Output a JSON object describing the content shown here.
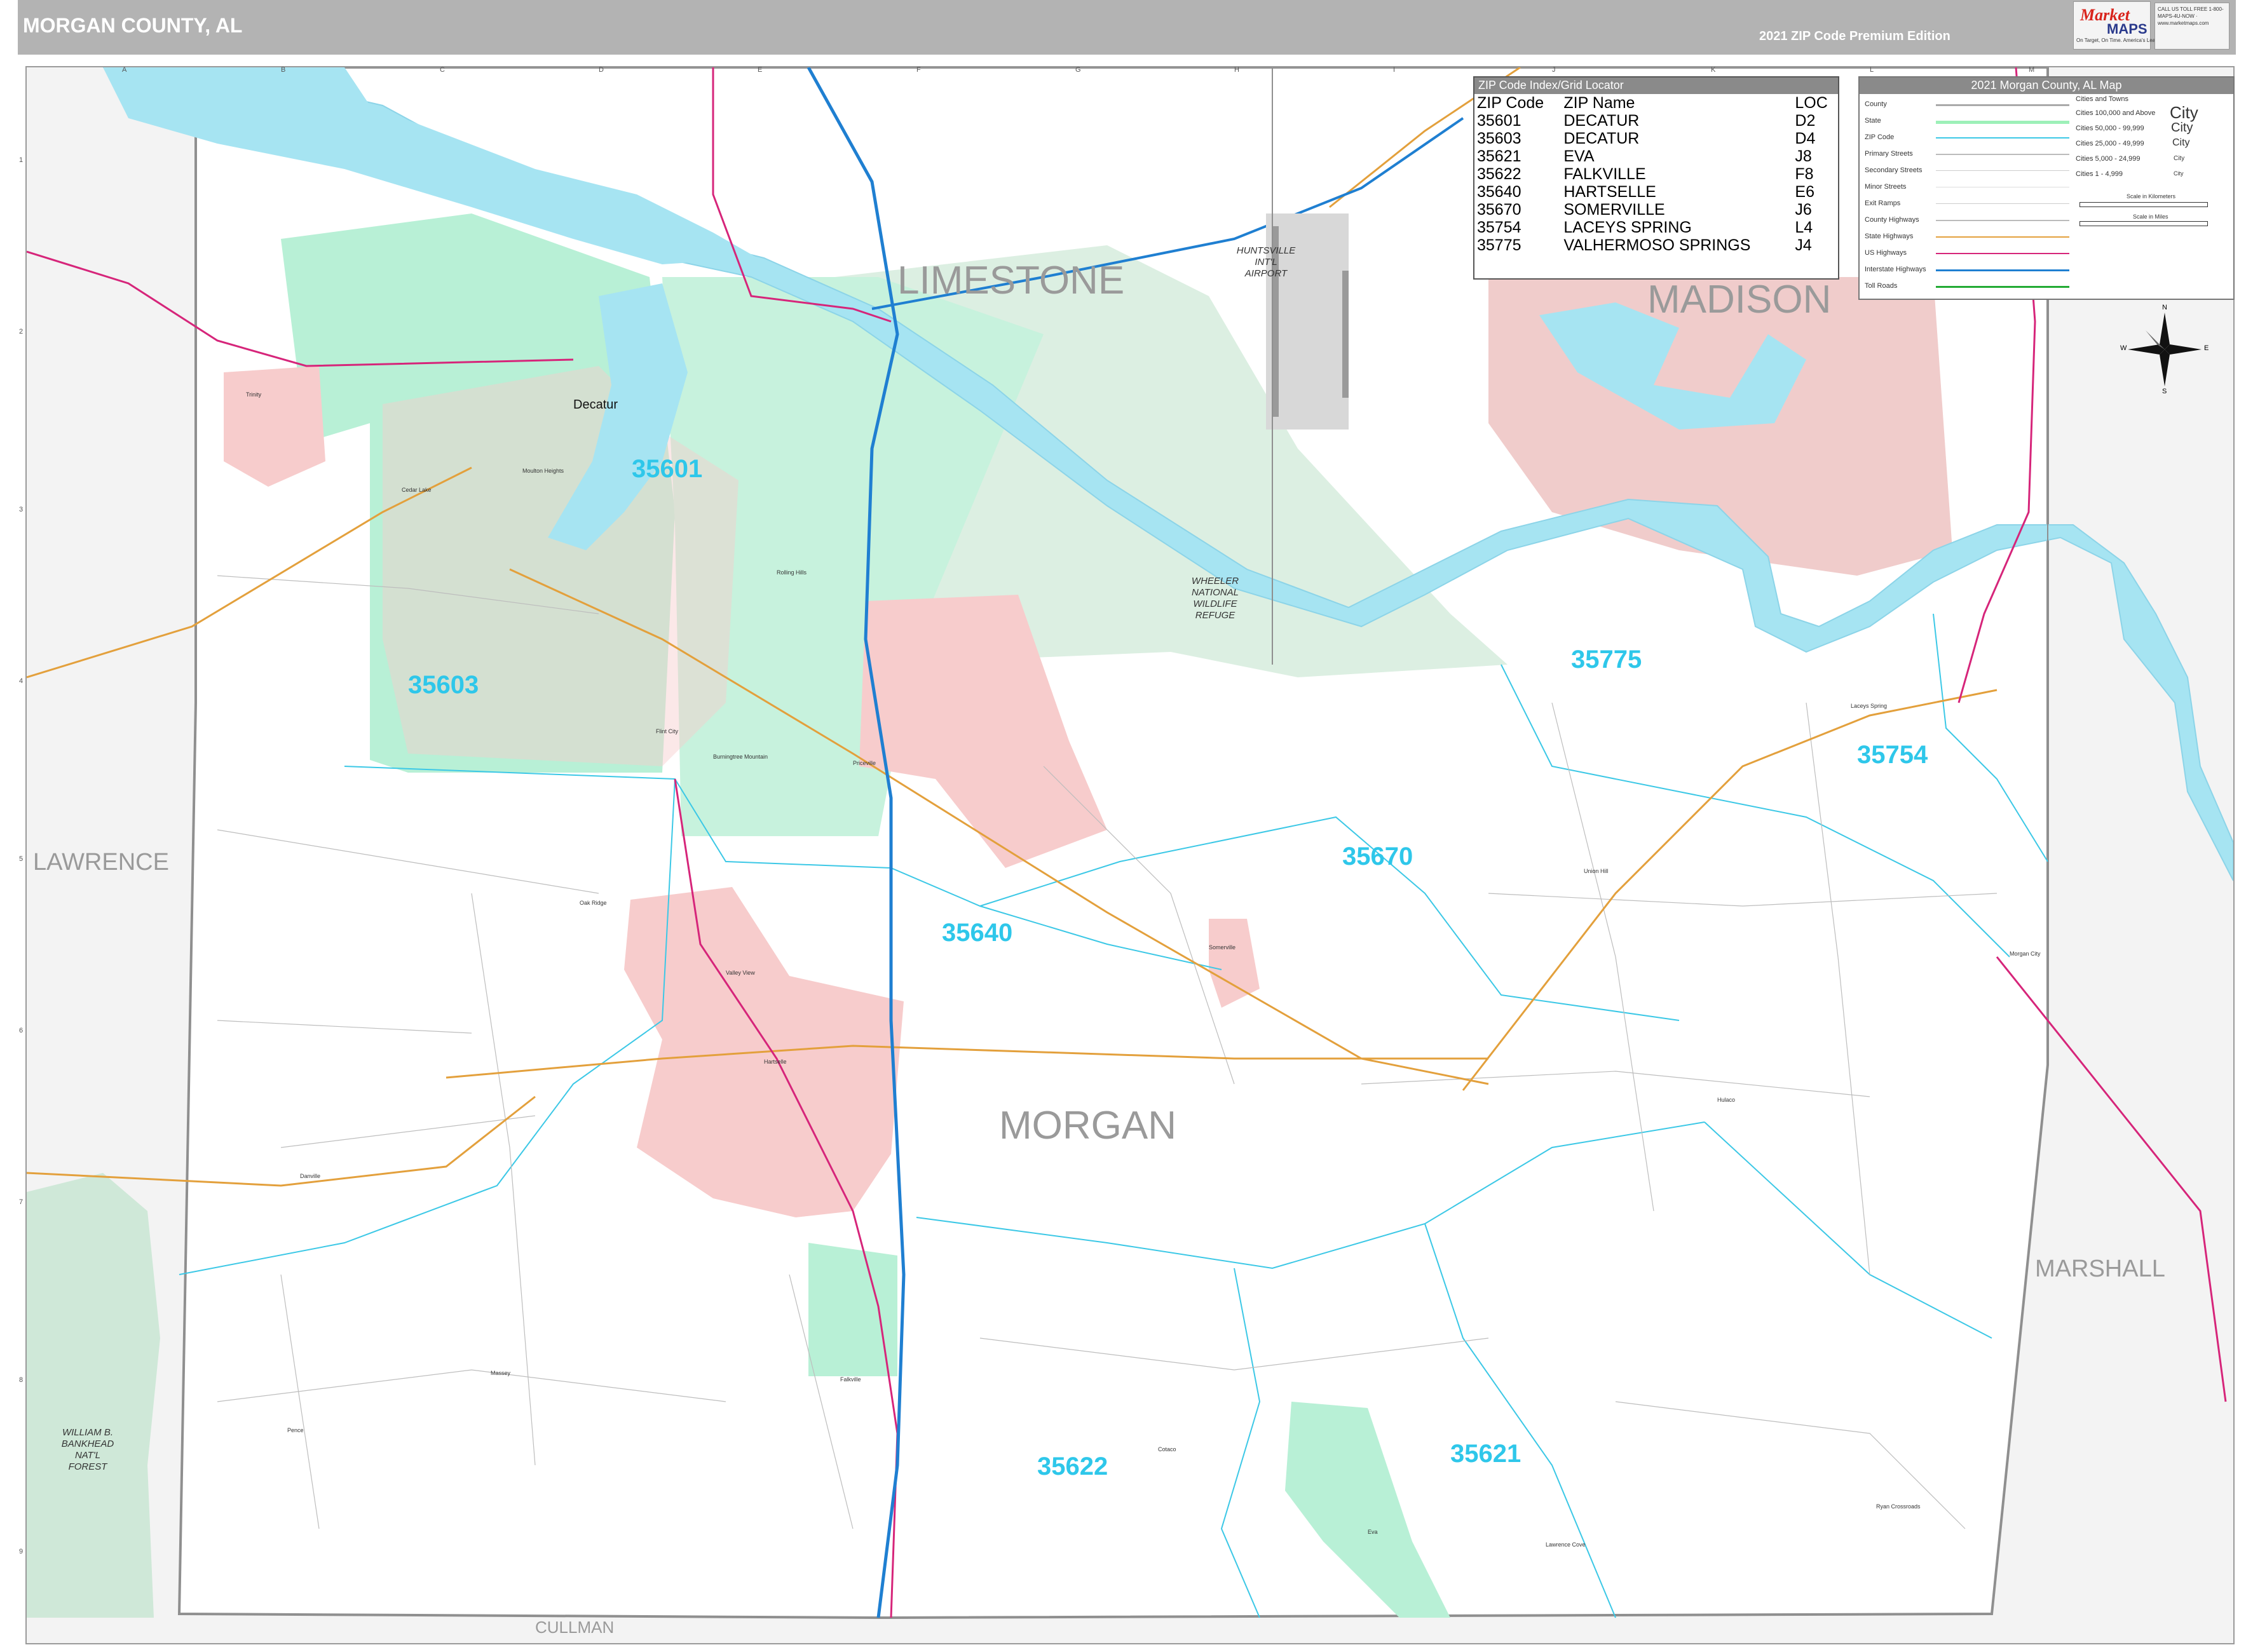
{
  "header": {
    "title": "MORGAN COUNTY, AL",
    "edition": "2021 ZIP Code Premium Edition"
  },
  "logo": {
    "brand_top": "Market",
    "brand_bottom": "MAPS",
    "tagline": "On Target, On Time. America's Leading Source of Business Maps",
    "contact": "CALL US TOLL FREE 1-800-MAPS-4U-NOW · www.marketmaps.com"
  },
  "colors": {
    "water": "#a6e4f2",
    "zip_boundary": "#3cc8e6",
    "interstate": "#1f7fd1",
    "us_highway": "#d6257a",
    "state_highway": "#e3a03c",
    "city_fill": "#f7cccc",
    "zip_shade": "#b8f0d6",
    "park_fill": "#cfe8d8",
    "county_line": "#8f8f8f",
    "zip_label": "#2ec7ea"
  },
  "zip_index": {
    "title": "ZIP Code Index/Grid Locator",
    "columns": [
      "ZIP Code",
      "ZIP Name",
      "LOC"
    ],
    "rows": [
      [
        "35601",
        "DECATUR",
        "D2"
      ],
      [
        "35603",
        "DECATUR",
        "D4"
      ],
      [
        "35621",
        "EVA",
        "J8"
      ],
      [
        "35622",
        "FALKVILLE",
        "F8"
      ],
      [
        "35640",
        "HARTSELLE",
        "E6"
      ],
      [
        "35670",
        "SOMERVILLE",
        "J6"
      ],
      [
        "35754",
        "LACEYS SPRING",
        "L4"
      ],
      [
        "35775",
        "VALHERMOSO SPRINGS",
        "J4"
      ]
    ]
  },
  "legend": {
    "title": "2021 Morgan County, AL Map",
    "items": [
      "County",
      "State",
      "ZIP Code",
      "Primary Streets",
      "Secondary Streets",
      "Minor Streets",
      "Exit Ramps",
      "County Highways",
      "State Highways",
      "US Highways",
      "Interstate Highways",
      "Toll Roads"
    ],
    "cities_heading": "Cities and Towns",
    "city_tiers": [
      {
        "label": "Cities 100,000 and Above",
        "sample": "City"
      },
      {
        "label": "Cities 50,000 - 99,999",
        "sample": "City"
      },
      {
        "label": "Cities 25,000 - 49,999",
        "sample": "City"
      },
      {
        "label": "Cities 5,000 - 24,999",
        "sample": "City"
      },
      {
        "label": "Cities 1 - 4,999",
        "sample": "City"
      }
    ],
    "scale_km": "Scale in Kilometers",
    "scale_mi": "Scale in Miles"
  },
  "compass": {
    "n": "N",
    "s": "S",
    "e": "E",
    "w": "W"
  },
  "grid": {
    "columns": [
      "A",
      "B",
      "C",
      "D",
      "E",
      "F",
      "G",
      "H",
      "I",
      "J",
      "K",
      "L",
      "M"
    ],
    "rows": [
      "1",
      "2",
      "3",
      "4",
      "5",
      "6",
      "7",
      "8",
      "9"
    ]
  },
  "counties": {
    "center": "MORGAN",
    "north": "LIMESTONE",
    "northeast": "MADISON",
    "west": "LAWRENCE",
    "east": "MARSHALL",
    "south": "CULLMAN"
  },
  "zip_labels": [
    "35601",
    "35603",
    "35640",
    "35670",
    "35775",
    "35754",
    "35622",
    "35621"
  ],
  "places": {
    "decatur": "Decatur",
    "airport": "HUNTSVILLE INT'L AIRPORT",
    "wheeler": "WHEELER NATIONAL WILDLIFE REFUGE",
    "bankhead": "WILLIAM B. BANKHEAD NAT'L FOREST",
    "small": [
      "Trinity",
      "Moulton Heights",
      "Priceville",
      "Rolling Hills",
      "Burningtree Mountain",
      "Hartselle",
      "Somerville",
      "Falkville",
      "Eva",
      "Danville",
      "Laceys Spring",
      "Union Hill",
      "Valley View",
      "Oak Ridge",
      "Massey",
      "Cotaco",
      "Lawrence Cove",
      "Ryan Crossroads",
      "Morgan City",
      "Flint City",
      "Pence",
      "Cedar Lake",
      "Hulaco"
    ]
  }
}
